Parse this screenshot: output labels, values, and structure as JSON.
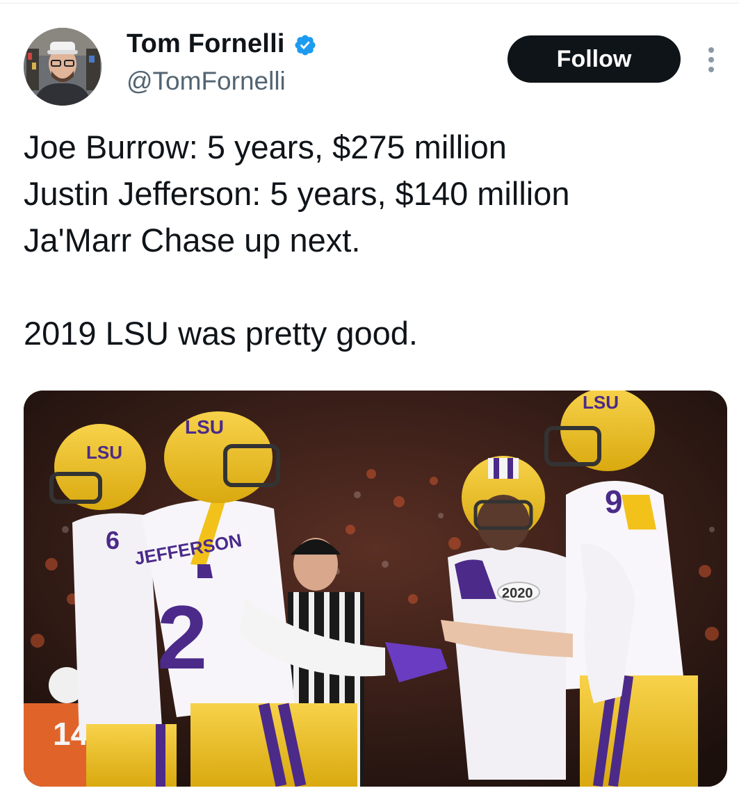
{
  "tweet": {
    "author": {
      "display_name": "Tom Fornelli",
      "handle": "@TomFornelli",
      "verified": true,
      "avatar_icon": "user-avatar"
    },
    "follow_label": "Follow",
    "more_icon": "more-options-icon",
    "text_lines": [
      "Joe Burrow: 5 years, $275 million",
      "Justin Jefferson: 5 years, $140 million",
      "Ja'Marr Chase up next.",
      "",
      "2019 LSU was pretty good."
    ],
    "media": {
      "kind": "photo",
      "visible_text": {
        "helmet_left": "LSU",
        "helmet_center": "LSU",
        "helmet_right": "LSU",
        "jersey_left_number": "6",
        "jersey_center_name": "JEFFERSON",
        "jersey_center_number": "2",
        "jersey_right_number": "9",
        "patch": "2020",
        "background_number": "14"
      }
    }
  },
  "colors": {
    "text_primary": "#0f1419",
    "text_secondary": "#536471",
    "verified_blue": "#1d9bf0",
    "lsu_gold": "#f2c21b",
    "lsu_purple": "#4b2a8a"
  }
}
